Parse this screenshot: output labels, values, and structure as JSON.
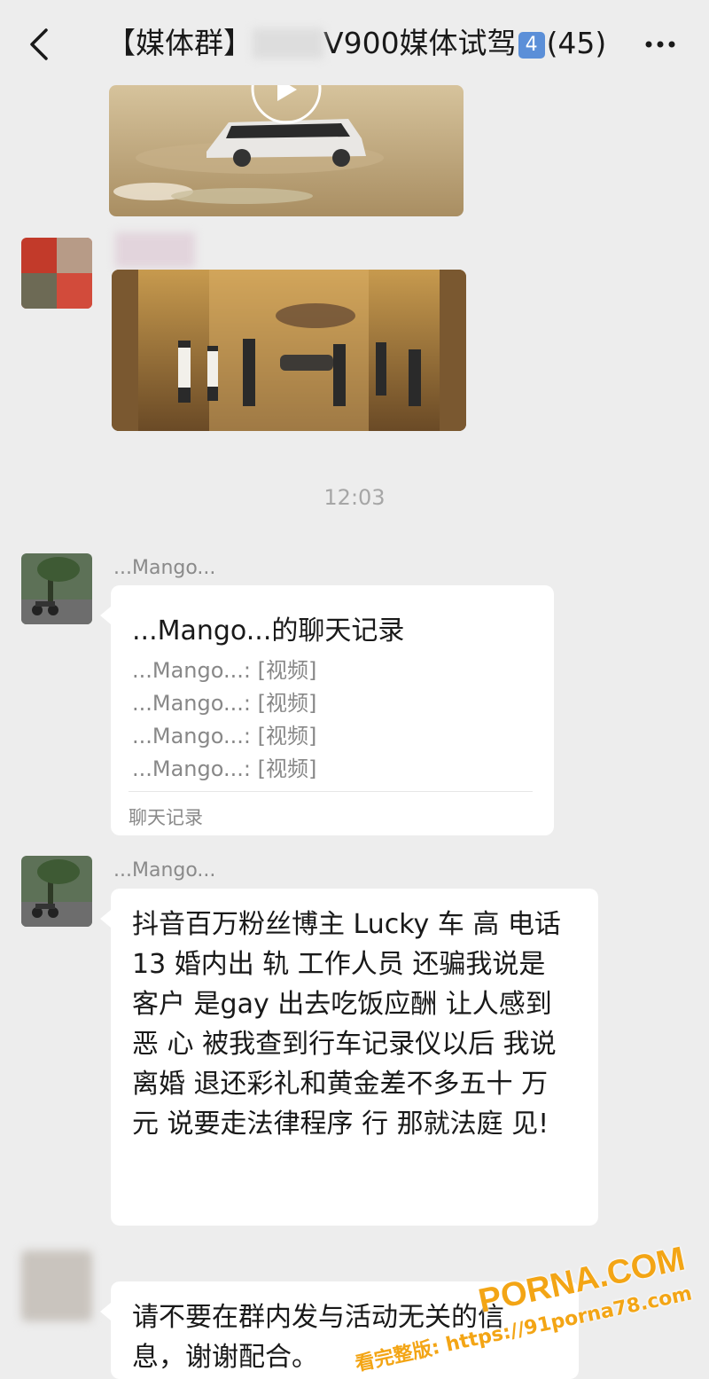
{
  "header": {
    "title_prefix": "【媒体群】",
    "title_main": "V900媒体试驾",
    "badge": "4",
    "member_count": "(45)"
  },
  "messages": [
    {
      "type": "time",
      "text": "12:03"
    },
    {
      "type": "chat_record",
      "nickname": "...Mango...",
      "title": "...Mango...的聊天记录",
      "lines": [
        "...Mango...: [视频]",
        "...Mango...: [视频]",
        "...Mango...: [视频]",
        "...Mango...: [视频]"
      ],
      "footer": "聊天记录"
    },
    {
      "type": "text",
      "nickname": "...Mango...",
      "text": "抖音百万粉丝博主 Lucky 车 高 电话 13 婚内出 轨 工作人员 还骗我说是客户 是gay 出去吃饭应酬 让人感到恶 心 被我查到行车记录仪以后 我说 离婚 退还彩礼和黄金差不多五十 万元 说要走法律程序 行 那就法庭 见!"
    },
    {
      "type": "text",
      "nickname": "",
      "text": "请不要在群内发与活动无关的信 息，谢谢配合。"
    }
  ],
  "watermark": {
    "line1": "PORNA.COM",
    "line2": "看完整版: https://91porna78.com"
  },
  "colors": {
    "background": "#ededed",
    "bubble": "#ffffff",
    "badge": "#5b8fd8",
    "watermark": "#f3a515"
  },
  "icons": [
    "back-arrow-icon",
    "more-dots-icon",
    "video-play-icon"
  ]
}
